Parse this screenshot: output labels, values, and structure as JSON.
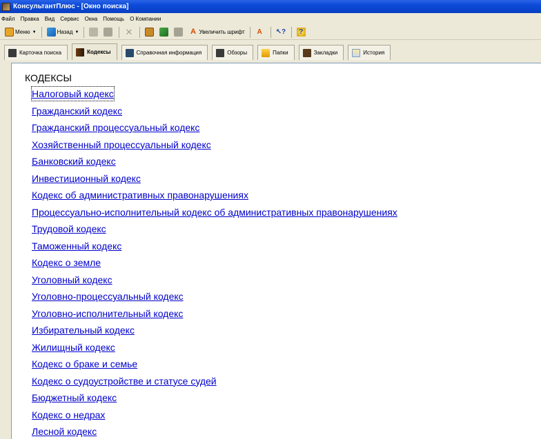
{
  "window": {
    "title": "КонсультантПлюс - [Окно поиска]"
  },
  "menu": [
    "Файл",
    "Правка",
    "Вид",
    "Сервис",
    "Окна",
    "Помощь",
    "О Компании"
  ],
  "toolbar": {
    "menu_label": "Меню",
    "back_label": "Назад",
    "font_label": "Увеличить шрифт"
  },
  "tabs": [
    {
      "label": "Карточка поиска",
      "icon": "binoculars-icon",
      "active": false
    },
    {
      "label": "Кодексы",
      "icon": "books-icon",
      "active": true
    },
    {
      "label": "Справочная информация",
      "icon": "binoculars-icon",
      "active": false
    },
    {
      "label": "Обзоры",
      "icon": "binoculars-icon",
      "active": false
    },
    {
      "label": "Папки",
      "icon": "folder-icon",
      "active": false
    },
    {
      "label": "Закладки",
      "icon": "bookmark-icon",
      "active": false
    },
    {
      "label": "История",
      "icon": "history-icon",
      "active": false
    }
  ],
  "content": {
    "heading": "КОДЕКСЫ",
    "links": [
      "Налоговый кодекс",
      "Гражданский кодекс",
      "Гражданский процессуальный кодекс",
      "Хозяйственный процессуальный кодекс",
      "Банковский кодекс",
      "Инвестиционный кодекс",
      "Кодекс об административных правонарушениях",
      "Процессуально-исполнительный кодекс об административных правонарушениях",
      "Трудовой кодекс",
      "Таможенный кодекс",
      "Кодекс о земле",
      "Уголовный кодекс",
      "Уголовно-процессуальный кодекс",
      "Уголовно-исполнительный кодекс",
      "Избирательный кодекс",
      "Жилищный кодекс",
      "Кодекс о браке и семье",
      "Кодекс о судоустройстве и статусе судей",
      "Бюджетный кодекс",
      "Кодекс о недрах",
      "Лесной кодекс"
    ]
  },
  "colors": {
    "link": "#0000cc",
    "title_bar": "#0b4ad8",
    "chrome": "#ece9d8"
  }
}
